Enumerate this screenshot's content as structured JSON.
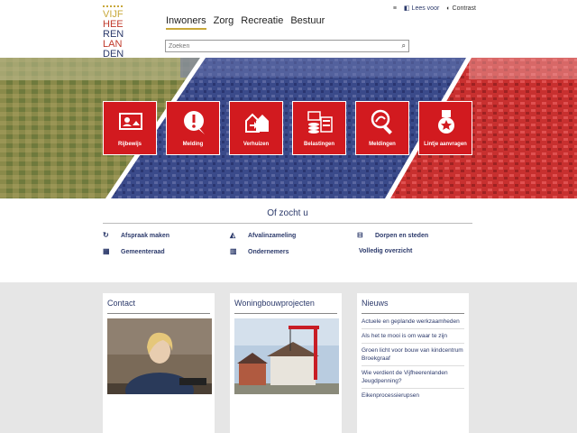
{
  "logo": {
    "l1": "VIJF",
    "l2": "HEE",
    "l3": "REN",
    "l4": "LAN",
    "l5": "DEN"
  },
  "util": {
    "icon1": "≡",
    "lees": "Lees voor",
    "contrast": "Contrast"
  },
  "nav": [
    {
      "label": "Inwoners"
    },
    {
      "label": "Zorg"
    },
    {
      "label": "Recreatie"
    },
    {
      "label": "Bestuur"
    }
  ],
  "search": {
    "placeholder": "Zoeken"
  },
  "tiles": [
    {
      "label": "Rijbewijs",
      "icon": "id-card-icon"
    },
    {
      "label": "Melding",
      "icon": "alert-icon"
    },
    {
      "label": "Verhuizen",
      "icon": "moving-house-icon"
    },
    {
      "label": "Belastingen",
      "icon": "taxes-icon"
    },
    {
      "label": "Meldingen",
      "icon": "magnifier-icon"
    },
    {
      "label": "Lintje aanvragen",
      "icon": "medal-icon"
    }
  ],
  "of_zocht_u": {
    "title": "Of zocht u",
    "links": [
      {
        "label": "Afspraak maken",
        "icon": "appointment-icon"
      },
      {
        "label": "Afvalinzameling",
        "icon": "waste-truck-icon"
      },
      {
        "label": "Dorpen en steden",
        "icon": "signpost-icon"
      },
      {
        "label": "Gemeenteraad",
        "icon": "council-icon"
      },
      {
        "label": "Ondernemers",
        "icon": "business-icon"
      },
      {
        "label": "Volledig overzicht",
        "icon": ""
      }
    ]
  },
  "cards": {
    "contact": {
      "title": "Contact"
    },
    "woningbouw": {
      "title": "Woningbouwprojecten"
    },
    "nieuws": {
      "title": "Nieuws",
      "items": [
        "Actuele en geplande werkzaamheden",
        "Als het te mooi is om waar te zijn",
        "Groen licht voor bouw van kindcentrum Broekgraaf",
        "Wie verdient de Vijfheerenlanden Jeugdpenning?",
        "Eikenprocessierupsen"
      ]
    }
  },
  "colors": {
    "red": "#d21a1f",
    "navy": "#2c3a6b",
    "gold": "#c8a83a"
  }
}
